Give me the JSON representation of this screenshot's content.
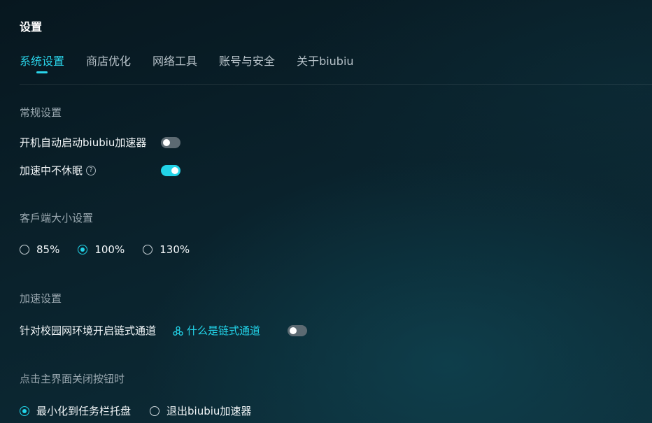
{
  "page": {
    "title": "设置"
  },
  "tabs": [
    {
      "label": "系统设置",
      "active": true
    },
    {
      "label": "商店优化",
      "active": false
    },
    {
      "label": "网络工具",
      "active": false
    },
    {
      "label": "账号与安全",
      "active": false
    },
    {
      "label": "关于biubiu",
      "active": false
    }
  ],
  "general": {
    "title": "常规设置",
    "auto_start": {
      "label": "开机自动启动biubiu加速器",
      "enabled": false
    },
    "no_sleep": {
      "label": "加速中不休眠",
      "help_icon": "question-circle-icon",
      "enabled": true
    }
  },
  "client_size": {
    "title": "客戶端大小设置",
    "options": [
      "85%",
      "100%",
      "130%"
    ],
    "selected": "100%"
  },
  "acceleration": {
    "title": "加速设置",
    "chain_channel": {
      "label": "针对校园网环境开启链式通道",
      "link_label": "什么是链式通道",
      "link_icon": "chain-nodes-icon",
      "enabled": false
    }
  },
  "close_behavior": {
    "title": "点击主界面关闭按钮时",
    "options": [
      "最小化到任务栏托盘",
      "退出biubiu加速器"
    ],
    "selected": "最小化到任务栏托盘"
  },
  "colors": {
    "accent": "#22d3e8",
    "toggle_off": "#5c6a72",
    "section_title": "#9aa8b0"
  }
}
